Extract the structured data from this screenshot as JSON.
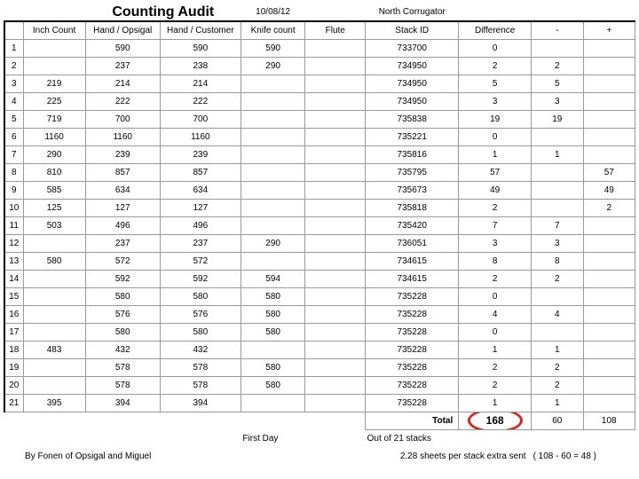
{
  "header": {
    "title": "Counting Audit",
    "date": "10/08/12",
    "location": "North Corrugator"
  },
  "columns": {
    "rownum": "",
    "inch": "Inch Count",
    "hand_opsigal": "Hand / Opsigal",
    "hand_customer": "Hand / Customer",
    "knife": "Knife count",
    "flute": "Flute",
    "stack": "Stack ID",
    "diff": "Difference",
    "minus": "-",
    "plus": "+"
  },
  "rows": [
    {
      "n": "1",
      "inch": "",
      "h1": "590",
      "h2": "590",
      "knife": "590",
      "flute": "",
      "stack": "733700",
      "diff": "0",
      "m": "",
      "p": ""
    },
    {
      "n": "2",
      "inch": "",
      "h1": "237",
      "h2": "238",
      "knife": "290",
      "flute": "",
      "stack": "734950",
      "diff": "2",
      "m": "2",
      "p": ""
    },
    {
      "n": "3",
      "inch": "219",
      "h1": "214",
      "h2": "214",
      "knife": "",
      "flute": "",
      "stack": "734950",
      "diff": "5",
      "m": "5",
      "p": ""
    },
    {
      "n": "4",
      "inch": "225",
      "h1": "222",
      "h2": "222",
      "knife": "",
      "flute": "",
      "stack": "734950",
      "diff": "3",
      "m": "3",
      "p": ""
    },
    {
      "n": "5",
      "inch": "719",
      "h1": "700",
      "h2": "700",
      "knife": "",
      "flute": "",
      "stack": "735838",
      "diff": "19",
      "m": "19",
      "p": ""
    },
    {
      "n": "6",
      "inch": "1160",
      "h1": "1160",
      "h2": "1160",
      "knife": "",
      "flute": "",
      "stack": "735221",
      "diff": "0",
      "m": "",
      "p": ""
    },
    {
      "n": "7",
      "inch": "290",
      "h1": "239",
      "h2": "239",
      "knife": "",
      "flute": "",
      "stack": "735816",
      "diff": "1",
      "m": "1",
      "p": ""
    },
    {
      "n": "8",
      "inch": "810",
      "h1": "857",
      "h2": "857",
      "knife": "",
      "flute": "",
      "stack": "735795",
      "diff": "57",
      "m": "",
      "p": "57"
    },
    {
      "n": "9",
      "inch": "585",
      "h1": "634",
      "h2": "634",
      "knife": "",
      "flute": "",
      "stack": "735673",
      "diff": "49",
      "m": "",
      "p": "49"
    },
    {
      "n": "10",
      "inch": "125",
      "h1": "127",
      "h2": "127",
      "knife": "",
      "flute": "",
      "stack": "735818",
      "diff": "2",
      "m": "",
      "p": "2"
    },
    {
      "n": "11",
      "inch": "503",
      "h1": "496",
      "h2": "496",
      "knife": "",
      "flute": "",
      "stack": "735420",
      "diff": "7",
      "m": "7",
      "p": ""
    },
    {
      "n": "12",
      "inch": "",
      "h1": "237",
      "h2": "237",
      "knife": "290",
      "flute": "",
      "stack": "736051",
      "diff": "3",
      "m": "3",
      "p": ""
    },
    {
      "n": "13",
      "inch": "580",
      "h1": "572",
      "h2": "572",
      "knife": "",
      "flute": "",
      "stack": "734615",
      "diff": "8",
      "m": "8",
      "p": ""
    },
    {
      "n": "14",
      "inch": "",
      "h1": "592",
      "h2": "592",
      "knife": "594",
      "flute": "",
      "stack": "734615",
      "diff": "2",
      "m": "2",
      "p": ""
    },
    {
      "n": "15",
      "inch": "",
      "h1": "580",
      "h2": "580",
      "knife": "580",
      "flute": "",
      "stack": "735228",
      "diff": "0",
      "m": "",
      "p": ""
    },
    {
      "n": "16",
      "inch": "",
      "h1": "576",
      "h2": "576",
      "knife": "580",
      "flute": "",
      "stack": "735228",
      "diff": "4",
      "m": "4",
      "p": ""
    },
    {
      "n": "17",
      "inch": "",
      "h1": "580",
      "h2": "580",
      "knife": "580",
      "flute": "",
      "stack": "735228",
      "diff": "0",
      "m": "",
      "p": ""
    },
    {
      "n": "18",
      "inch": "483",
      "h1": "432",
      "h2": "432",
      "knife": "",
      "flute": "",
      "stack": "735228",
      "diff": "1",
      "m": "1",
      "p": ""
    },
    {
      "n": "19",
      "inch": "",
      "h1": "578",
      "h2": "578",
      "knife": "580",
      "flute": "",
      "stack": "735228",
      "diff": "2",
      "m": "2",
      "p": ""
    },
    {
      "n": "20",
      "inch": "",
      "h1": "578",
      "h2": "578",
      "knife": "580",
      "flute": "",
      "stack": "735228",
      "diff": "2",
      "m": "2",
      "p": ""
    },
    {
      "n": "21",
      "inch": "395",
      "h1": "394",
      "h2": "394",
      "knife": "",
      "flute": "",
      "stack": "735228",
      "diff": "1",
      "m": "1",
      "p": ""
    }
  ],
  "totals": {
    "label": "Total",
    "diff": "168",
    "minus": "60",
    "plus": "108"
  },
  "footer": {
    "firstday": "First Day",
    "stacks": "Out of 21 stacks",
    "byline": "By Fonen of Opsigal and Miguel",
    "extra": "2.28 sheets per stack extra sent",
    "calc": "( 108 - 60 = 48 )"
  }
}
